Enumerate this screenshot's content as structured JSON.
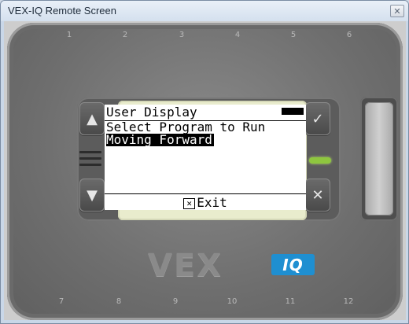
{
  "window": {
    "title": "VEX-IQ Remote Screen",
    "close_glyph": "✕"
  },
  "brain": {
    "ports_top": [
      "1",
      "2",
      "3",
      "4",
      "5",
      "6"
    ],
    "ports_bottom": [
      "7",
      "8",
      "9",
      "10",
      "11",
      "12"
    ],
    "buttons": {
      "up_glyph": "▲",
      "down_glyph": "▼",
      "check_glyph": "✓",
      "x_glyph": "✕"
    },
    "led_color": "#8ec63f",
    "logo": {
      "text": "VEX",
      "badge": "IQ",
      "accent": "#1f8fd1"
    }
  },
  "screen": {
    "title": "User Display",
    "prompt": "Select Program to Run",
    "selected_program": "Moving Forward",
    "exit_icon": "✕",
    "exit_label": "Exit"
  }
}
